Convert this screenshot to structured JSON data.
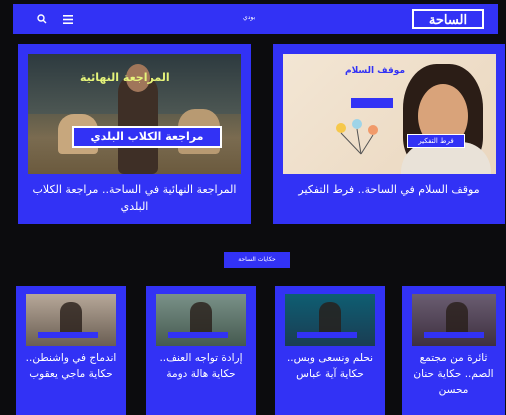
{
  "header": {
    "logo_text": "الساحة",
    "live_label": "بودي",
    "search_icon": "search-icon",
    "menu_icon": "menu-icon"
  },
  "features": [
    {
      "title": "المراجعة النهائية في الساحة.. مراجعة الكلاب البلدي",
      "image_caption": "مراجعة الكلاب البلدي",
      "image_badge": "المراجعة النهائية"
    },
    {
      "title": "موقف السلام في الساحة.. فرط التفكير",
      "image_caption": "فرط التفكير",
      "image_badge": "موقف السلام"
    }
  ],
  "section": {
    "label": "حكايات الساحة"
  },
  "cards": [
    {
      "title": "اندماج في واشنطن.. حكاية ماجي يعقوب"
    },
    {
      "title": "إرادة تواجه العنف.. حكاية هالة دومة"
    },
    {
      "title": "نحلم ونسعى وبس.. حكاية آية عباس"
    },
    {
      "title": "ثائرة من مجتمع الصم.. حكاية حنان محسن"
    }
  ],
  "colors": {
    "accent": "#3232f5",
    "background": "#0c0c0e",
    "text": "#ffffff"
  }
}
